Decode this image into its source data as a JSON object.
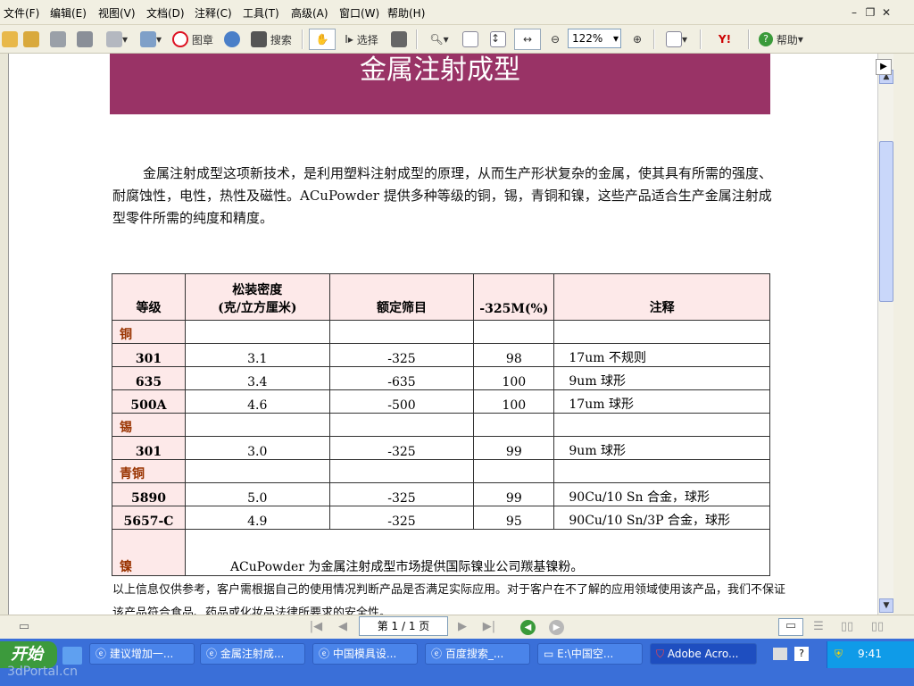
{
  "menu": [
    "文件(F)",
    "编辑(E)",
    "视图(V)",
    "文档(D)",
    "注释(C)",
    "工具(T)",
    "高级(A)",
    "窗口(W)",
    "帮助(H)"
  ],
  "window_controls": [
    "–",
    "❐",
    "✕"
  ],
  "toolbar": {
    "seal_label": "图章",
    "search_label": "搜索",
    "select_label": "选择",
    "zoom_value": "122%",
    "help_label": "帮助"
  },
  "document": {
    "title": "金属注射成型",
    "intro": "金属注射成型这项新技术，是利用塑料注射成型的原理，从而生产形状复杂的金属，使其具有所需的强度、耐腐蚀性，电性，热性及磁性。ACuPowder 提供多种等级的铜，锡，青铜和镍，这些产品适合生产金属注射成型零件所需的纯度和精度。",
    "table": {
      "headers": [
        "等级",
        "松装密度",
        "(克/立方厘米)",
        "额定筛目",
        "-325M(%)",
        "注释"
      ],
      "groups": {
        "copper": "铜",
        "tin": "锡",
        "bronze": "青铜",
        "nickel": "镍"
      },
      "rows": [
        {
          "grade": "301",
          "density": "3.1",
          "mesh": "-325",
          "pct": "98",
          "note": "17um 不规则"
        },
        {
          "grade": "635",
          "density": "3.4",
          "mesh": "-635",
          "pct": "100",
          "note": "9um 球形"
        },
        {
          "grade": "500A",
          "density": "4.6",
          "mesh": "-500",
          "pct": "100",
          "note": "17um 球形"
        },
        {
          "grade": "301",
          "density": "3.0",
          "mesh": "-325",
          "pct": "99",
          "note": "9um 球形"
        },
        {
          "grade": "5890",
          "density": "5.0",
          "mesh": "-325",
          "pct": "99",
          "note": "90Cu/10 Sn  合金，球形"
        },
        {
          "grade": "5657-C",
          "density": "4.9",
          "mesh": "-325",
          "pct": "95",
          "note": "90Cu/10 Sn/3P  合金，球形"
        }
      ],
      "nickel_note": "ACuPowder 为金属注射成型市场提供国际镍业公司羰基镍粉。"
    },
    "footnote": "以上信息仅供参考，客户需根据自己的使用情况判断产品是否满足实际应用。对于客户在不了解的应用领域使用该产品，我们不保证该产品符合食品、药品或化妆品法律所要求的安全性。"
  },
  "status": {
    "page_indicator": "第 1 / 1 页"
  },
  "taskbar": {
    "start_label": "开始",
    "tasks": [
      "建议增加一...",
      "金属注射成...",
      "中国模具设...",
      "百度搜索_...",
      "E:\\中国空...",
      "Adobe Acro..."
    ],
    "clock": "9:41",
    "watermark": "3dPortal.cn"
  },
  "colors": {
    "title_bg": "#993366",
    "header_bg": "#fde9e9",
    "group_text": "#993300",
    "taskbar": "#3a6fd8"
  }
}
